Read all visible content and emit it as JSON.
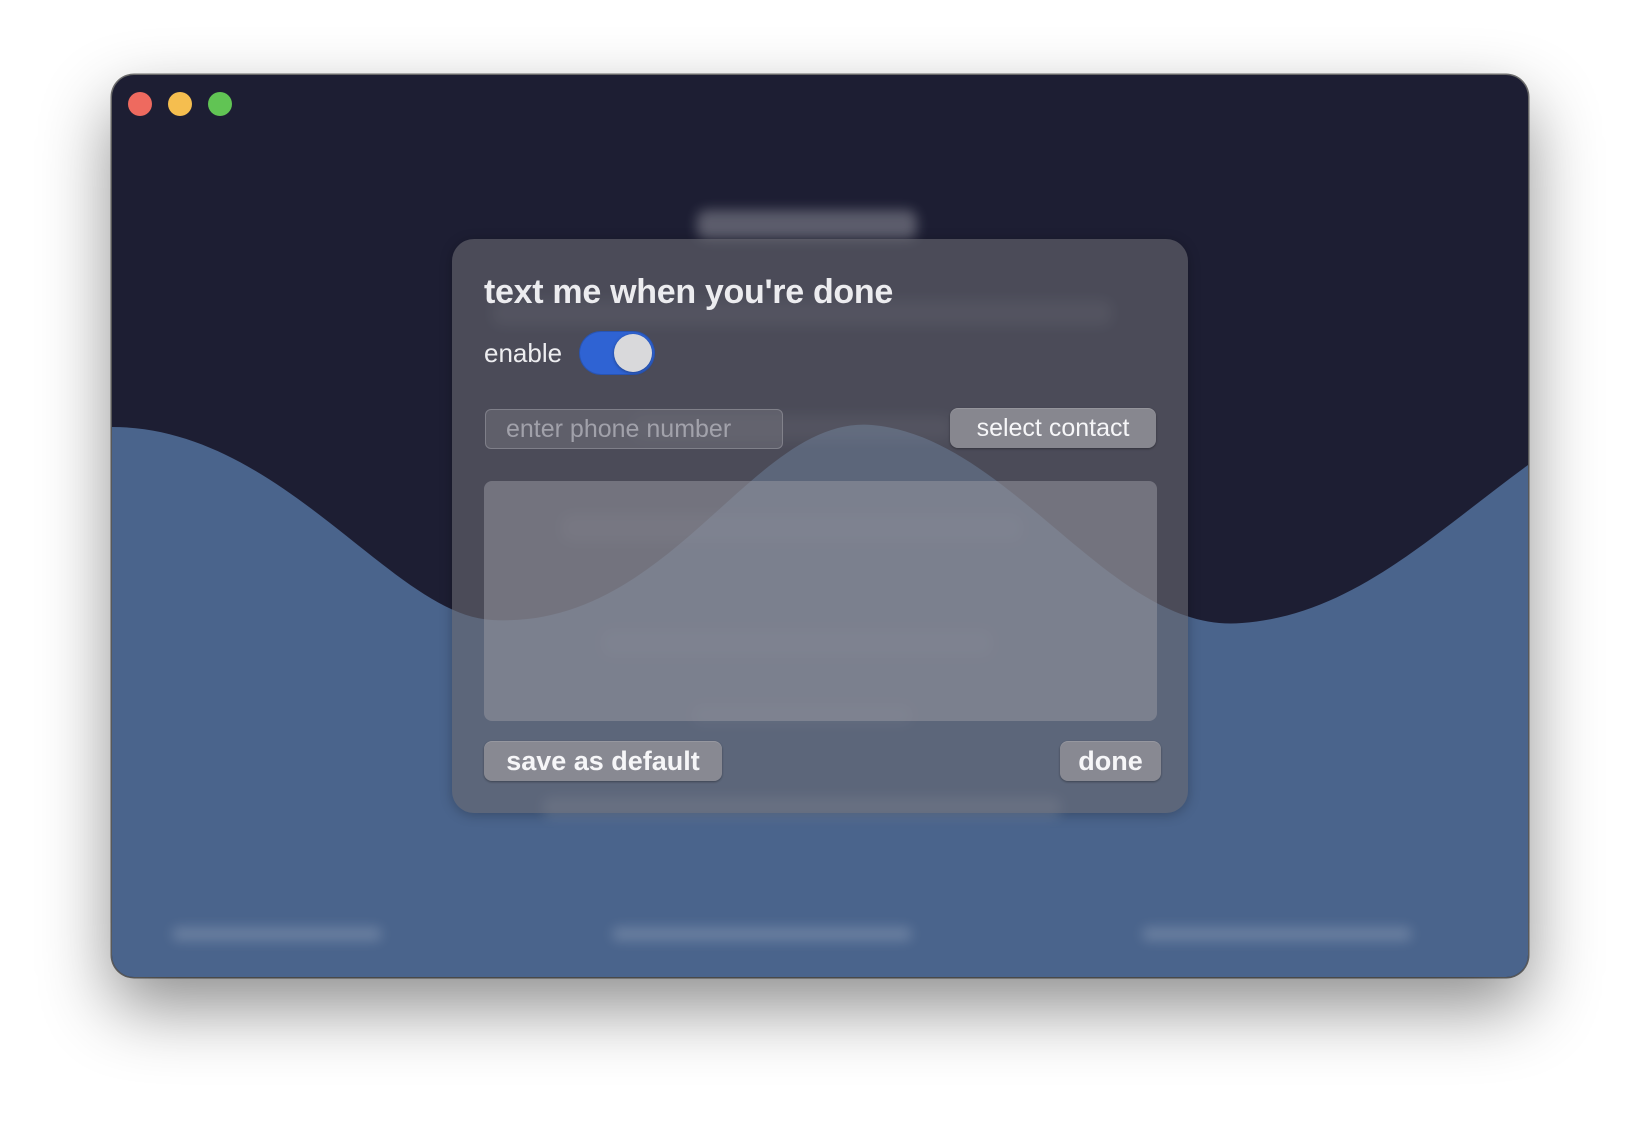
{
  "window": {
    "controls": [
      "close",
      "minimize",
      "zoom"
    ]
  },
  "dialog": {
    "title": "text me when you're done",
    "enable_label": "enable",
    "enable_on": true,
    "phone_placeholder": "enter phone number",
    "phone_value": "",
    "select_contact_label": "select contact",
    "message_value": "",
    "save_default_label": "save as default",
    "done_label": "done"
  },
  "colors": {
    "window_bg": "#1d1e33",
    "wave": "#4a648c",
    "toggle_on": "#2f63d3",
    "close": "#ee6a5f",
    "minimize": "#f5be4f",
    "zoom": "#61c454"
  }
}
